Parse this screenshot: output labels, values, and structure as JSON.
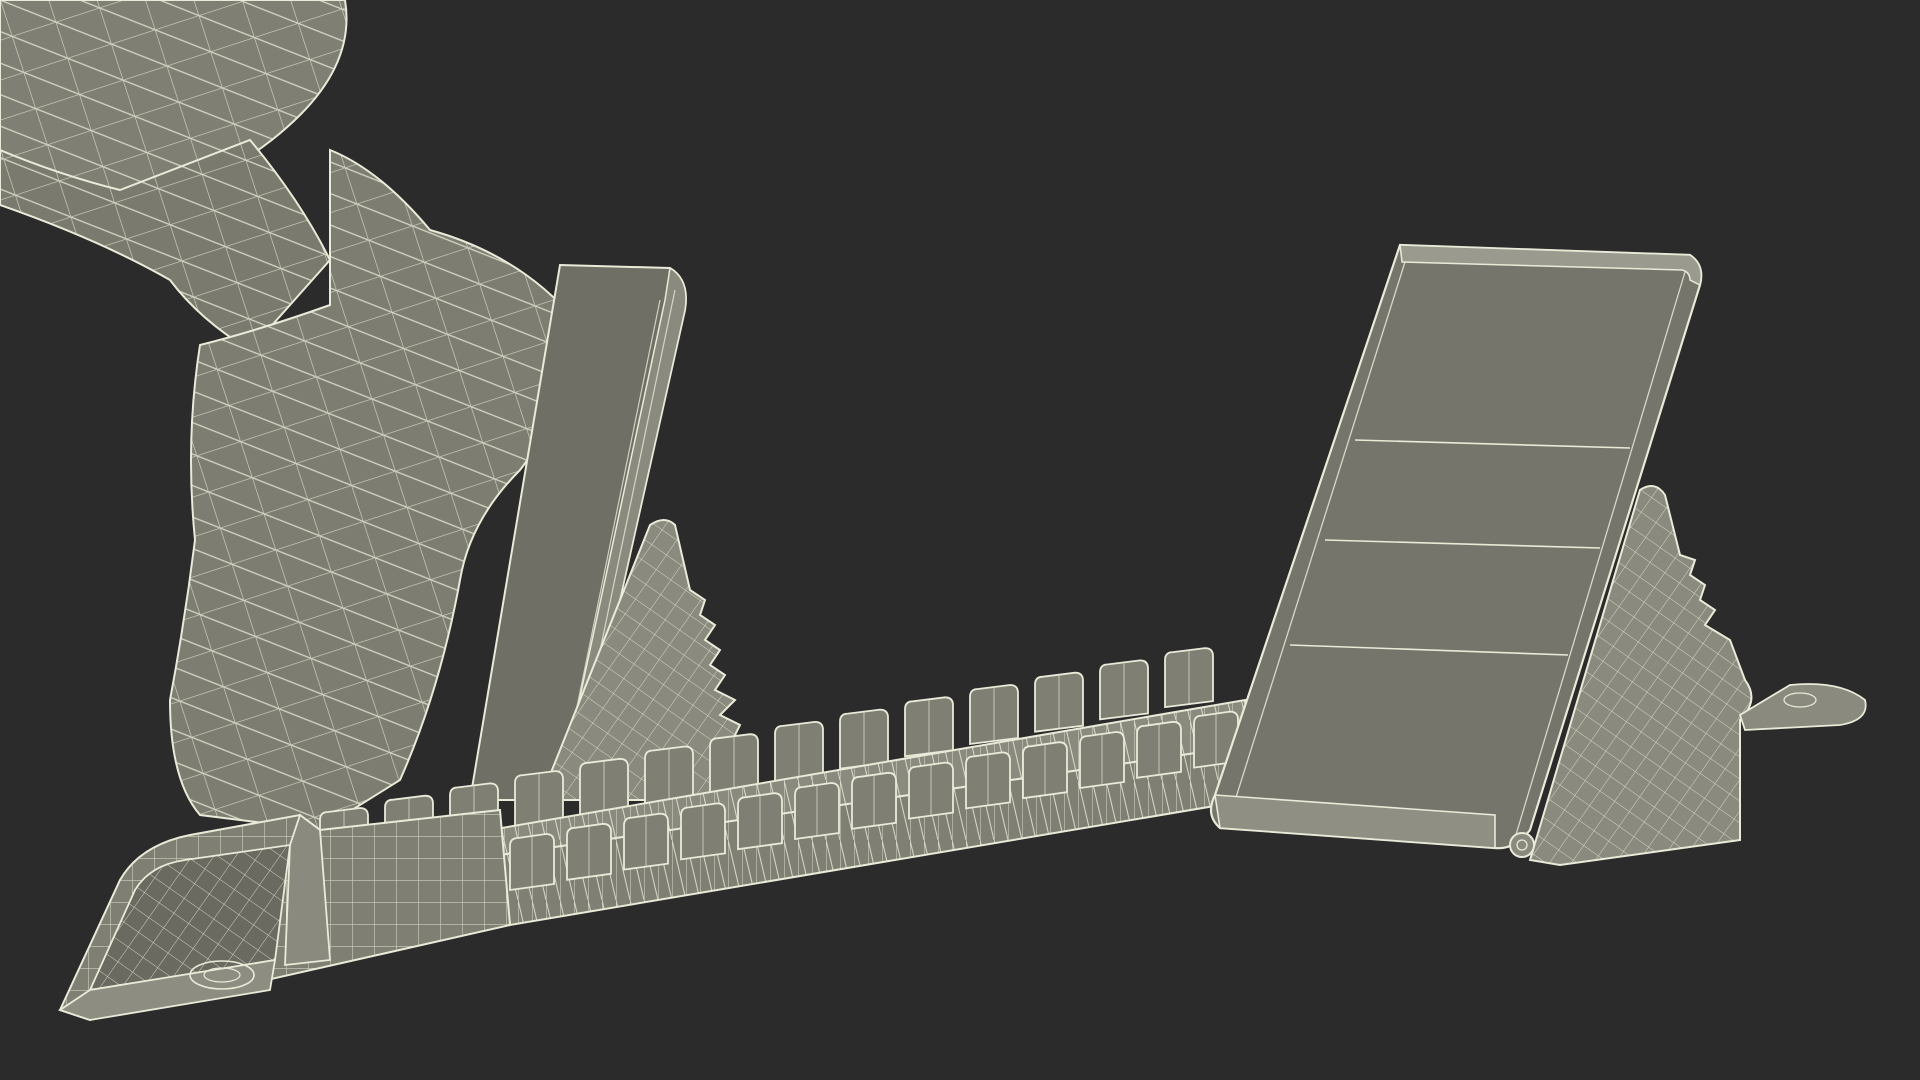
{
  "scene": {
    "subject": "starting-block-wireframe-render",
    "colors": {
      "background": "#2b2b2b",
      "surface": "#7f7f73",
      "surface_shade": "#6a6a60",
      "surface_dark": "#55554c",
      "wire": "#e9ead8"
    }
  }
}
